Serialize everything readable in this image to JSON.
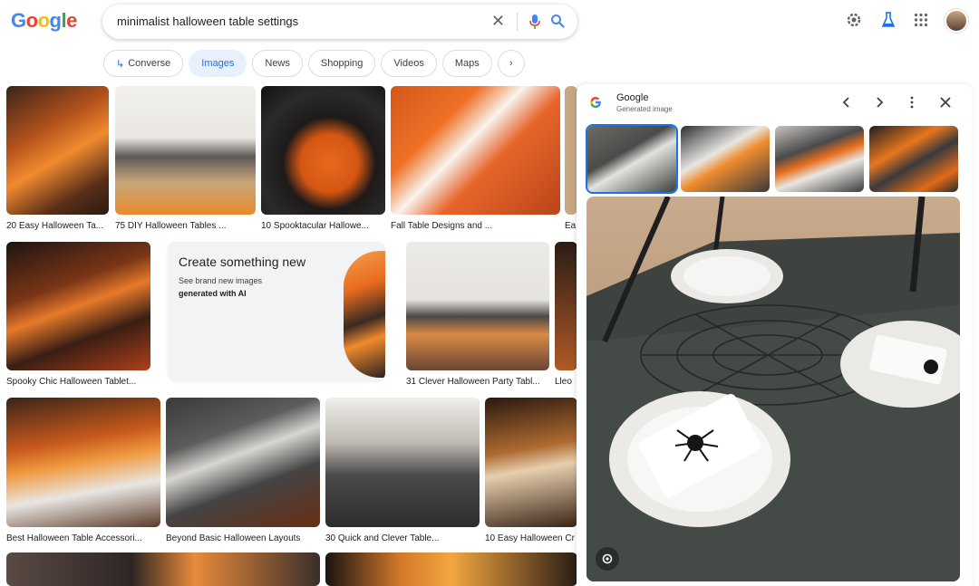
{
  "logo": [
    "G",
    "o",
    "o",
    "g",
    "l",
    "e"
  ],
  "search": {
    "query": "minimalist halloween table settings"
  },
  "chips": [
    {
      "label": "Converse",
      "active": false
    },
    {
      "label": "Images",
      "active": true
    },
    {
      "label": "News",
      "active": false
    },
    {
      "label": "Shopping",
      "active": false
    },
    {
      "label": "Videos",
      "active": false
    },
    {
      "label": "Maps",
      "active": false
    }
  ],
  "results": {
    "row1": [
      "20 Easy Halloween Ta...",
      "75 DIY Halloween Tables ...",
      "10 Spooktacular Hallowe...",
      "Fall Table Designs and ...",
      "Ea"
    ],
    "row2": [
      "Spooky Chic Halloween Tablet...",
      "31 Clever Halloween Party Tabl...",
      "Lleo"
    ],
    "row3": [
      "Best Halloween Table Accessori...",
      "Beyond Basic Halloween Layouts",
      "30 Quick and Clever Table...",
      "10 Easy Halloween Cr"
    ]
  },
  "create_card": {
    "title": "Create something new",
    "line1": "See brand new images",
    "line2": "generated with AI"
  },
  "panel": {
    "title": "Google",
    "subtitle": "Generated image"
  },
  "colors": {
    "accent": "#1a73e8",
    "chip_active_bg": "#e8f0fe"
  }
}
